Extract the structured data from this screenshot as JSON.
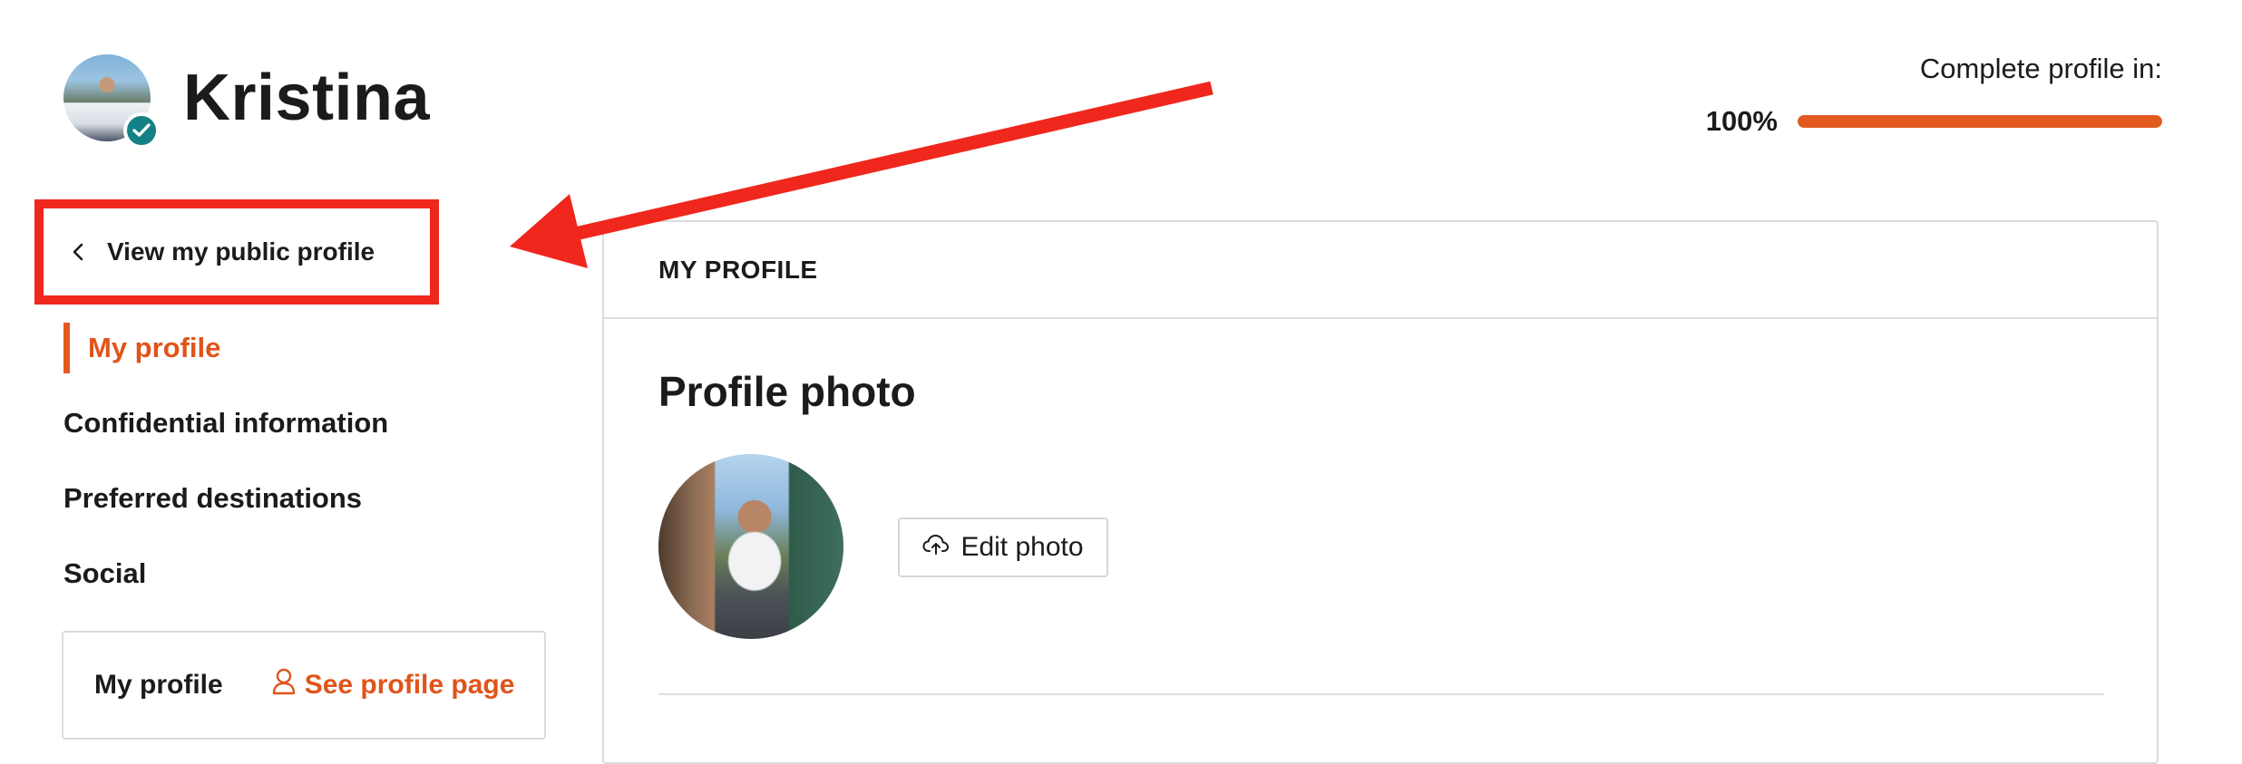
{
  "user": {
    "name": "Kristina"
  },
  "completion": {
    "label": "Complete profile in:",
    "value_text": "100%",
    "fraction": 1.0
  },
  "public_profile_link": {
    "label": "View my public profile"
  },
  "sidebar": {
    "items": [
      {
        "label": "My profile",
        "active": true
      },
      {
        "label": "Confidential information",
        "active": false
      },
      {
        "label": "Preferred destinations",
        "active": false
      },
      {
        "label": "Social",
        "active": false
      }
    ]
  },
  "profile_card": {
    "title": "My profile",
    "link_label": "See profile page"
  },
  "panel": {
    "header": "MY PROFILE",
    "section_title": "Profile photo",
    "edit_photo_label": "Edit photo"
  },
  "colors": {
    "accent": "#e35a1f",
    "annotation_red": "#f0271d",
    "verified_teal": "#138185"
  },
  "icons": [
    "verified-check-icon",
    "chevron-left-icon",
    "user-icon",
    "cloud-upload-icon"
  ]
}
